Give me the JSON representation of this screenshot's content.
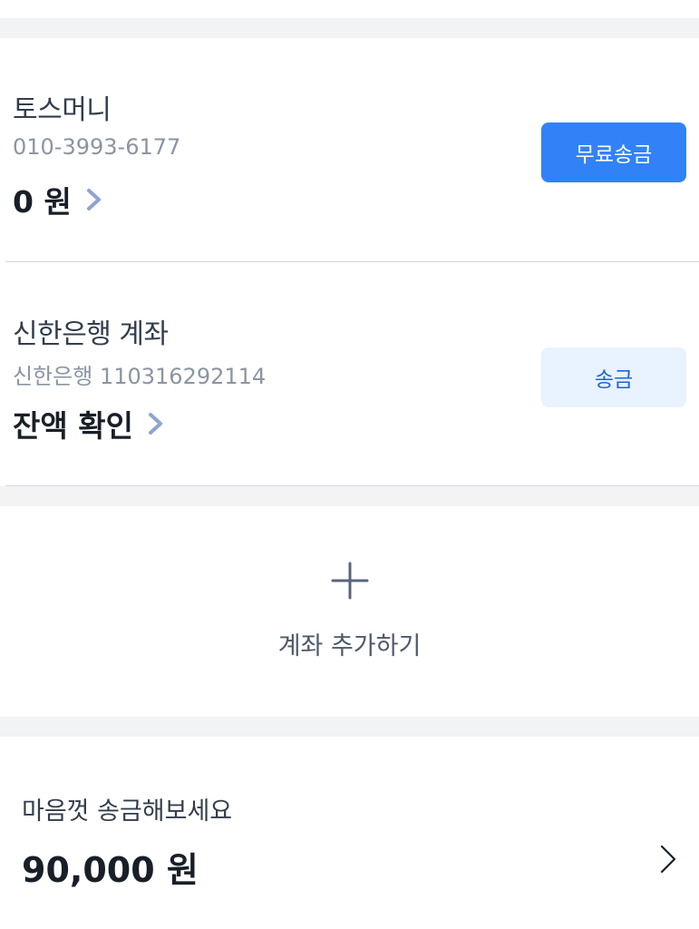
{
  "accounts": [
    {
      "name": "토스머니",
      "sub": "010-3993-6177",
      "balance": "0 원",
      "button": "무료송금"
    },
    {
      "name": "신한은행 계좌",
      "sub": "신한은행 110316292114",
      "balance": "잔액 확인",
      "button": "송금"
    }
  ],
  "add_account": {
    "label": "계좌 추가하기",
    "icon": "plus-icon"
  },
  "promo": {
    "title": "마음껏 송금해보세요",
    "amount": "90,000 원",
    "icon": "chevron-right-icon"
  },
  "colors": {
    "primary": "#3182f6",
    "primary_light": "#e8f3ff",
    "section_gap": "#f2f3f5",
    "chevron_blue": "#8fa4cf"
  }
}
